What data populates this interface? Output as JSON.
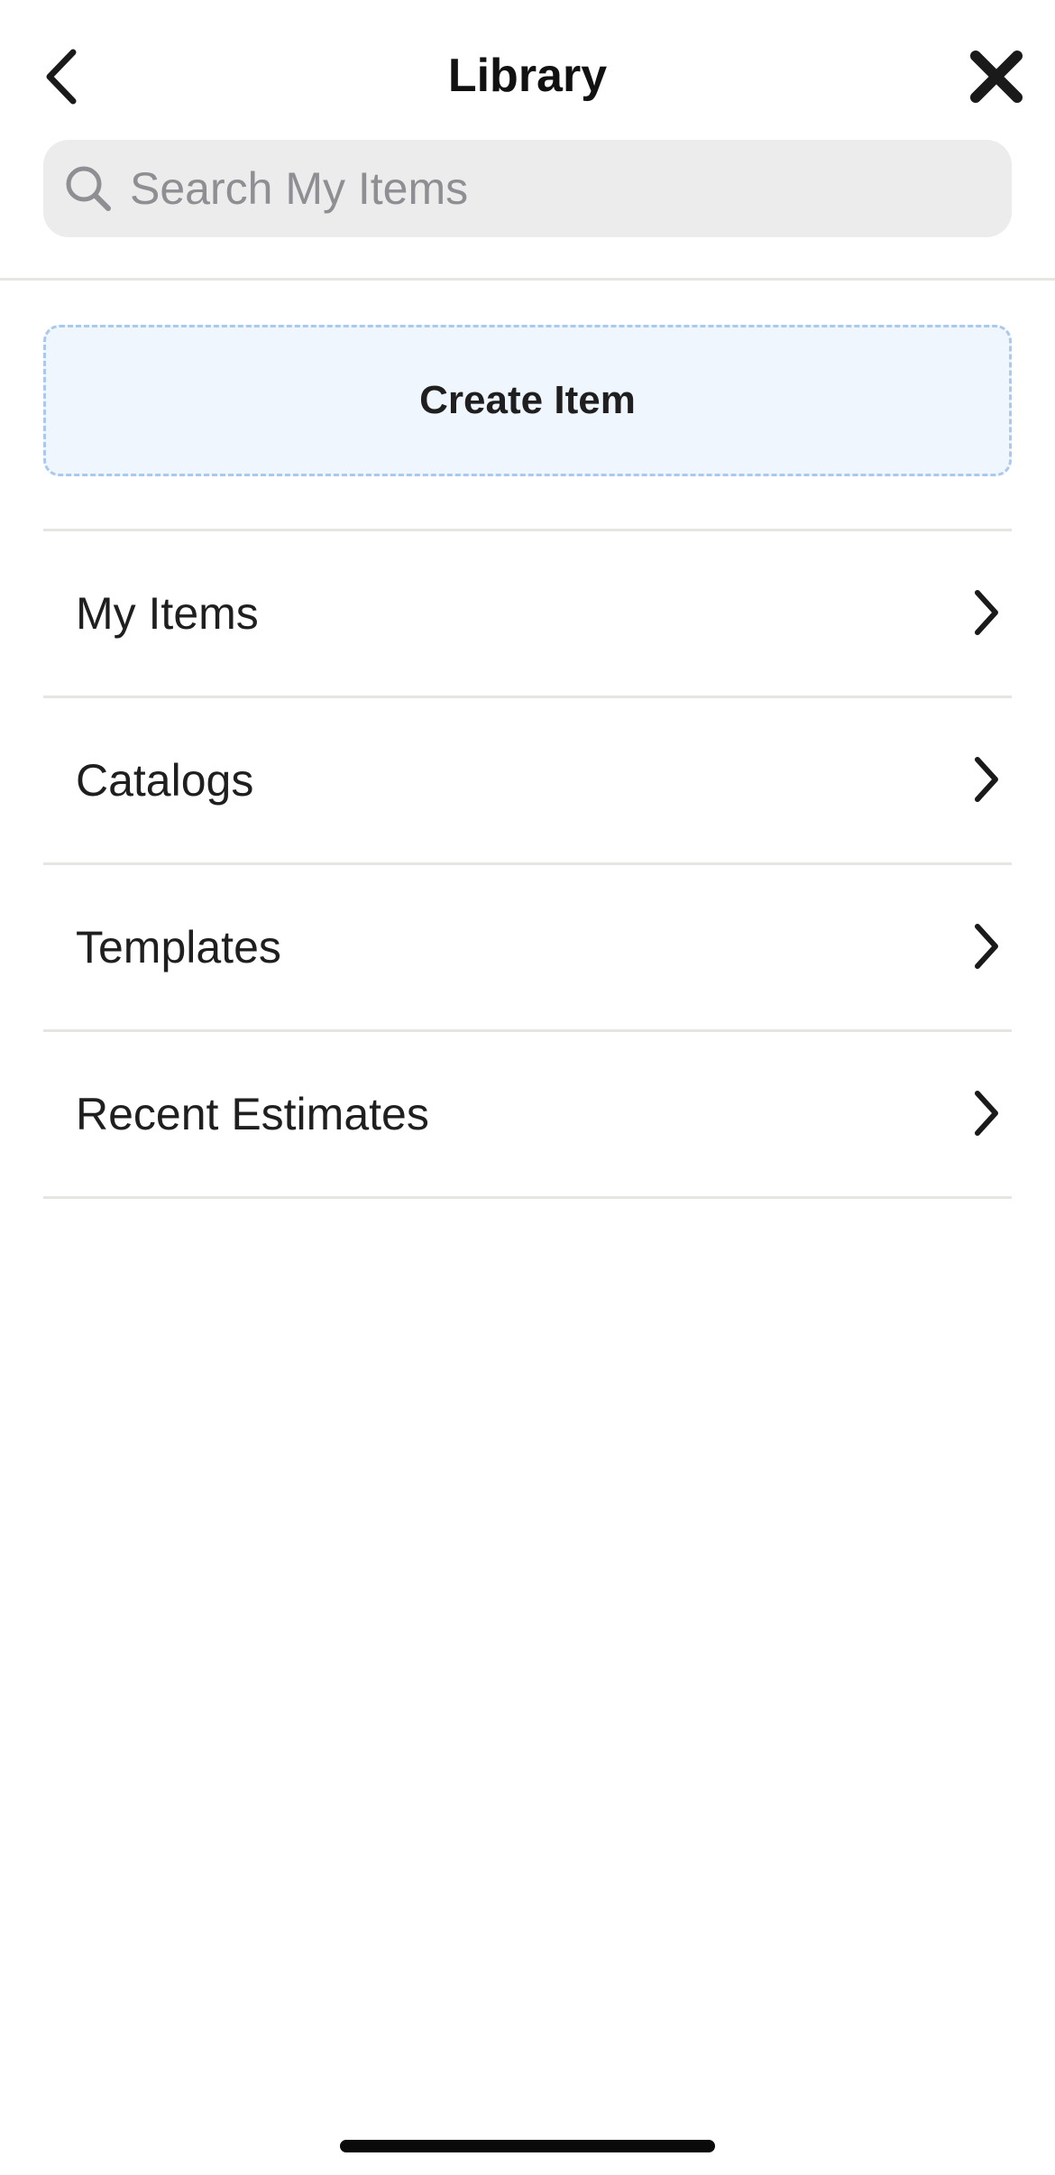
{
  "header": {
    "title": "Library",
    "back_icon": "chevron-left-icon",
    "close_icon": "close-x-icon"
  },
  "search": {
    "placeholder": "Search My Items",
    "value": "",
    "icon": "search-icon"
  },
  "create_item": {
    "label": "Create Item"
  },
  "menu": {
    "items": [
      {
        "label": "My Items",
        "icon": "chevron-right-icon"
      },
      {
        "label": "Catalogs",
        "icon": "chevron-right-icon"
      },
      {
        "label": "Templates",
        "icon": "chevron-right-icon"
      },
      {
        "label": "Recent Estimates",
        "icon": "chevron-right-icon"
      }
    ]
  },
  "colors": {
    "background": "#ffffff",
    "search_bg": "#ececed",
    "create_bg": "#f0f6fe",
    "create_border": "#a9c9ef",
    "divider": "#e6e6e1",
    "text": "#1f1f1f",
    "placeholder": "#8e8e93"
  }
}
